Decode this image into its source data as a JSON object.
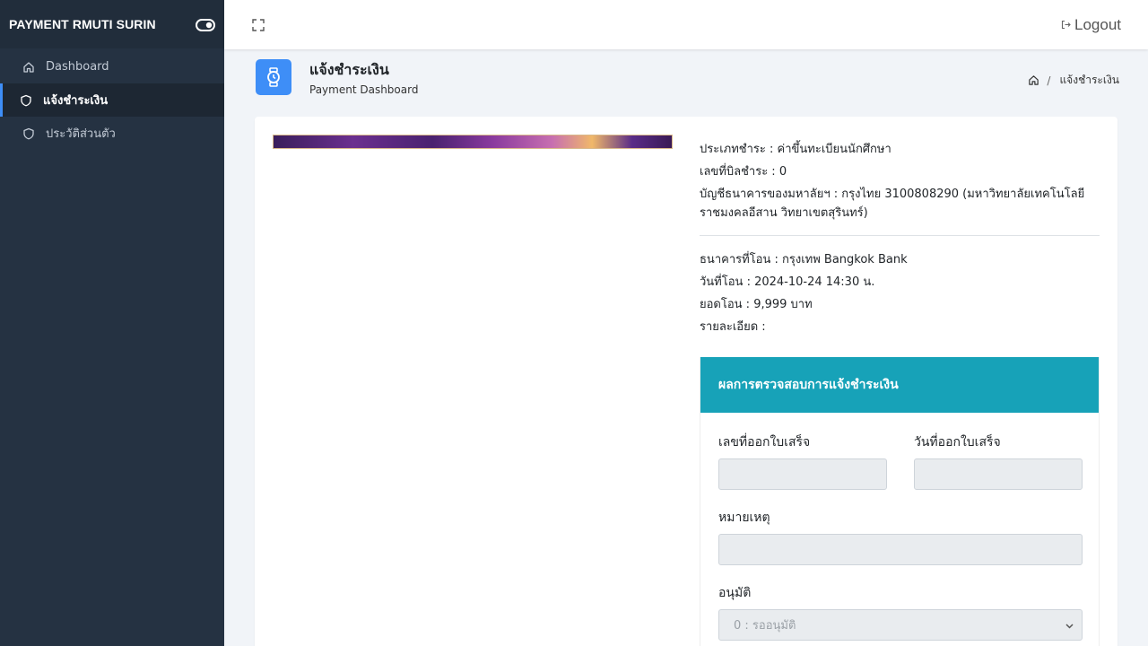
{
  "sidebar": {
    "brand": "PAYMENT RMUTI SURIN",
    "toggle_icon": "toggle-icon",
    "items": [
      {
        "label": "Dashboard",
        "icon": "home-icon",
        "active": false
      },
      {
        "label": "แจ้งชำระเงิน",
        "icon": "shield-icon",
        "active": true
      },
      {
        "label": "ประวัติส่วนตัว",
        "icon": "shield-icon",
        "active": false
      }
    ]
  },
  "topbar": {
    "fullscreen_icon": "fullscreen-icon",
    "logout_label": "Logout",
    "logout_icon": "logout-icon"
  },
  "page": {
    "icon": "watch-icon",
    "title": "แจ้งชำระเงิน",
    "subtitle": "Payment Dashboard",
    "breadcrumb": {
      "home_icon": "home-icon",
      "separator": "/",
      "current": "แจ้งชำระเงิน"
    }
  },
  "payment": {
    "type": "ประเภทชำระ : ค่าขึ้นทะเบียนนักศึกษา",
    "bill_no": "เลขที่บิลชำระ : 0",
    "account": "บัญชีธนาคารของมหาลัยฯ : กรุงไทย 3100808290 (มหาวิทยาลัยเทคโนโลยีราชมงคลอีสาน วิทยาเขตสุรินทร์)",
    "bank": "ธนาคารที่โอน : กรุงเทพ Bangkok Bank",
    "date": "วันที่โอน : 2024-10-24 14:30 น.",
    "amount": "ยอดโอน : 9,999 บาท",
    "detail": "รายละเอียด :"
  },
  "result": {
    "header": "ผลการตรวจสอบการแจ้งชำระเงิน",
    "receipt_no_label": "เลขที่ออกใบเสร็จ",
    "receipt_no_value": "",
    "receipt_date_label": "วันที่ออกใบเสร็จ",
    "receipt_date_value": "",
    "note_label": "หมายเหตุ",
    "note_value": "",
    "approve_label": "อนุมัติ",
    "approve_selected": "0 : รออนุมัติ"
  },
  "colors": {
    "sidebar_bg": "#253242",
    "accent": "#3e8ef7",
    "panel_header": "#17a2b8"
  }
}
